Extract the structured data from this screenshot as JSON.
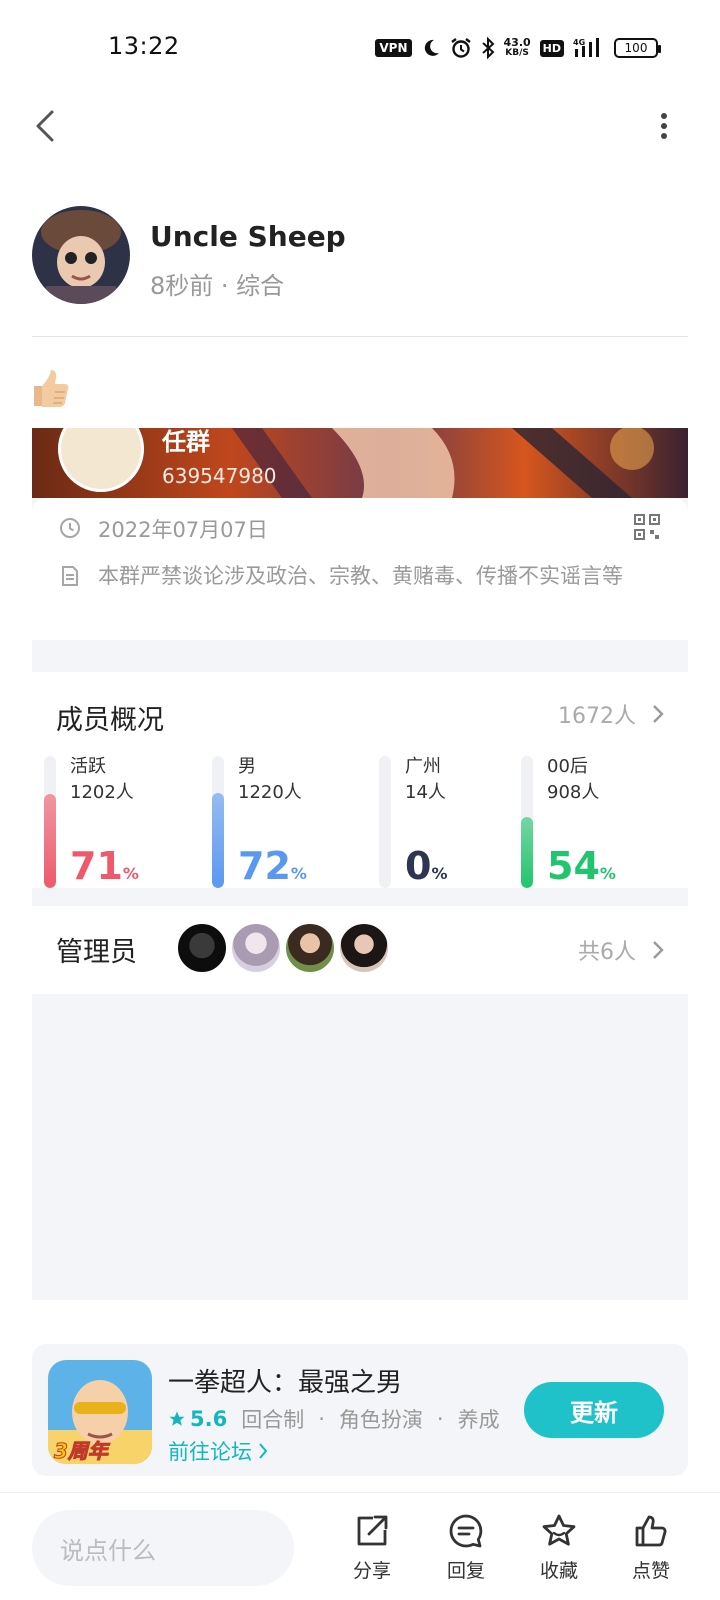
{
  "status_bar": {
    "time": "13:22",
    "vpn": "VPN",
    "net_speed_value": "43.0",
    "net_speed_unit": "KB/S",
    "hd": "HD",
    "signal_type": "4G",
    "battery": "100"
  },
  "author": {
    "name": "Uncle Sheep",
    "meta": "8秒前 · 综合"
  },
  "group_card": {
    "banner_name": "任群",
    "banner_id": "639547980",
    "date": "2022年07月07日",
    "rules": "本群严禁谈论涉及政治、宗教、黄赌毒、传播不实谣言等"
  },
  "members": {
    "title": "成员概况",
    "total": "1672人",
    "stats": [
      {
        "label": "活跃",
        "count": "1202人",
        "percent": 71,
        "color": "#ee5a6c"
      },
      {
        "label": "男",
        "count": "1220人",
        "percent": 72,
        "color": "#5a98f0"
      },
      {
        "label": "广州",
        "count": "14人",
        "percent": 0,
        "color": "#2d3550"
      },
      {
        "label": "00后",
        "count": "908人",
        "percent": 54,
        "color": "#22c46f"
      }
    ],
    "percent_unit": "%"
  },
  "admins": {
    "title": "管理员",
    "total": "共6人"
  },
  "game": {
    "title": "一拳超人：最强之男",
    "rating": "5.6",
    "tags": [
      "回合制",
      "角色扮演",
      "养成"
    ],
    "separator": "·",
    "forum_link": "前往论坛",
    "badge": "3周年",
    "update_label": "更新"
  },
  "bottom_bar": {
    "input_placeholder": "说点什么",
    "share": "分享",
    "reply": "回复",
    "favorite": "收藏",
    "like": "点赞"
  },
  "colors": {
    "accent": "#1ec2c8",
    "accent_text": "#13b7bd"
  }
}
